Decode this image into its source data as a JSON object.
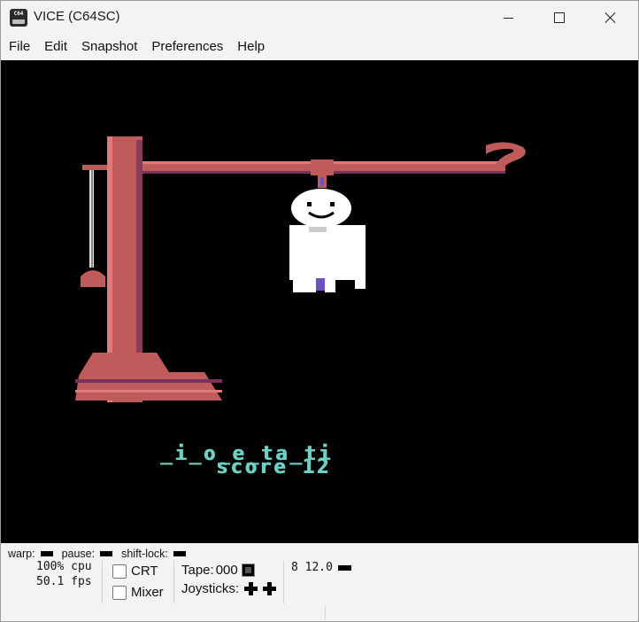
{
  "window": {
    "title": "VICE (C64SC)",
    "icon": "c64-app-icon",
    "icon_text": "C64"
  },
  "menu": {
    "items": [
      "File",
      "Edit",
      "Snapshot",
      "Preferences",
      "Help"
    ]
  },
  "game": {
    "word": "_i_o_e_ta_ti",
    "score_line": "score 12",
    "colors": {
      "background": "#000000",
      "gallows": "#c05b5b",
      "text": "#6ecfc4",
      "figure": "#ffffff"
    }
  },
  "status": {
    "warp_label": "warp:",
    "pause_label": "pause:",
    "shift_lock_label": "shift-lock:",
    "cpu": "100% cpu",
    "fps": "50.1 fps",
    "crt_label": "CRT",
    "mixer_label": "Mixer",
    "tape_label": "Tape:",
    "tape_counter": "000",
    "joysticks_label": "Joysticks:",
    "drive": "8 12.0",
    "crt_checked": false,
    "mixer_checked": false
  }
}
